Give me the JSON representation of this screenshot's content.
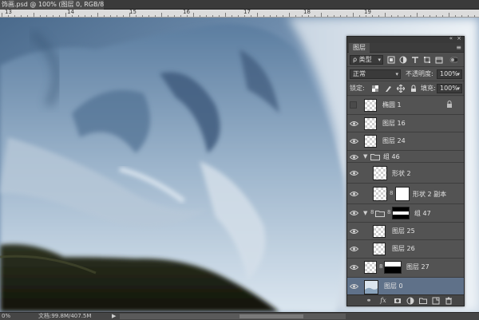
{
  "document": {
    "tab_title": "饰画.psd @ 100% (图层 0, RGB/8) *",
    "close_glyph": "×"
  },
  "ruler": {
    "labels": [
      "13",
      "14",
      "15",
      "16",
      "17",
      "18",
      "19"
    ]
  },
  "status": {
    "zoom": "0%",
    "doc_info": "文档:99.8M/407.5M",
    "arrow": "▶"
  },
  "layers_panel": {
    "tab_label": "图层",
    "collapse_glyph": "«",
    "close_glyph": "×",
    "menu_glyph": "≡",
    "filter": {
      "kind_label": "ρ 类型"
    },
    "blend_mode": "正常",
    "opacity_label": "不透明度:",
    "opacity_value": "100%",
    "lock_label": "锁定:",
    "fill_label": "填充:",
    "fill_value": "100%",
    "selection_color": "#5f7189",
    "layers": [
      {
        "name": "椭圆 1",
        "kind": "shape",
        "visible": false,
        "locked": true
      },
      {
        "name": "图层 16",
        "kind": "pixel",
        "visible": true
      },
      {
        "name": "图层 24",
        "kind": "pixel",
        "visible": true
      },
      {
        "name": "组 46",
        "kind": "group",
        "visible": true,
        "expanded": true
      },
      {
        "name": "形状 2",
        "kind": "pixel",
        "visible": true,
        "indent": true
      },
      {
        "name": "形状 2 副本",
        "kind": "masked",
        "visible": true,
        "indent": true
      },
      {
        "name": "组 47",
        "kind": "group-masked",
        "visible": true,
        "expanded": true
      },
      {
        "name": "图层 25",
        "kind": "pixel",
        "visible": true,
        "indent": true
      },
      {
        "name": "图层 26",
        "kind": "pixel",
        "visible": true,
        "indent": true
      },
      {
        "name": "图层 27",
        "kind": "masked",
        "visible": true
      },
      {
        "name": "图层 0",
        "kind": "image",
        "visible": true,
        "selected": true
      }
    ]
  }
}
